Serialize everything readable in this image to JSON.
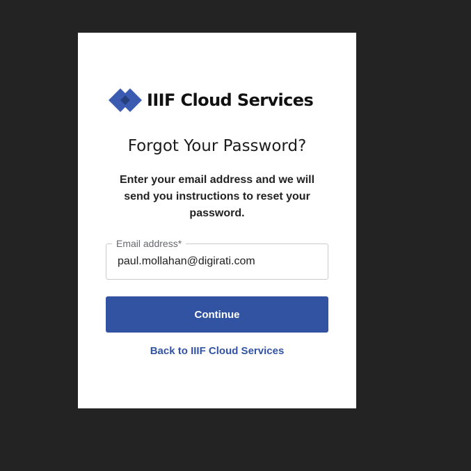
{
  "brand": {
    "name": "IIIF Cloud Services",
    "logo_icon": "double-diamond-logo-icon",
    "colors": {
      "primary": "#3253a2",
      "logo_light": "#3b5bb0",
      "logo_dark": "#26407f"
    }
  },
  "page": {
    "title": "Forgot Your Password?",
    "description": "Enter your email address and we will send you instructions to reset your password."
  },
  "form": {
    "email_label": "Email address*",
    "email_value": "paul.mollahan@digirati.com",
    "continue_label": "Continue"
  },
  "links": {
    "back_label": "Back to IIIF Cloud Services"
  }
}
